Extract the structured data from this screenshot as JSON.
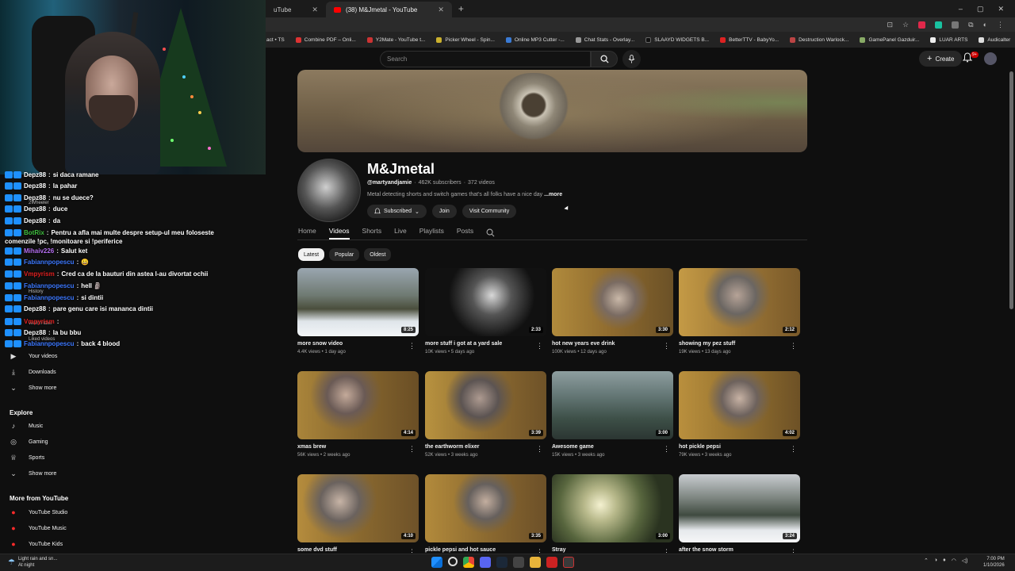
{
  "browser": {
    "tabs": [
      {
        "label": "uTube",
        "active": false
      },
      {
        "label": "(38) M&Jmetal - YouTube",
        "active": true
      }
    ],
    "bookmarks": [
      "act • TS",
      "Combine PDF – Onli...",
      "Y2Mate - YouTube t...",
      "Picker Wheel - Spin...",
      "Online MP3 Cutter -...",
      "Chat Stats - Overlay...",
      "SLAAYD WIDGETS B...",
      "BetterTTV - BabyYo...",
      "Destruction Warlock...",
      "GamePanel Gazduir...",
      "LUAR ARTS",
      "Audicalter"
    ]
  },
  "youtube_header": {
    "search_placeholder": "Search",
    "create_label": "Create",
    "notif_badge": "9+"
  },
  "channel": {
    "name": "M&Jmetal",
    "handle": "@martyandjamie",
    "subscribers": "462K subscribers",
    "video_count": "372 videos",
    "description": "Metal detecting shorts and switch games that's all folks have a nice day",
    "more_label": "...more",
    "subscribed_label": "Subscribed",
    "join_label": "Join",
    "community_label": "Visit Community"
  },
  "tabs": [
    "Home",
    "Videos",
    "Shorts",
    "Live",
    "Playlists",
    "Posts"
  ],
  "active_tab": "Videos",
  "chips": [
    "Latest",
    "Popular",
    "Oldest"
  ],
  "videos": [
    {
      "title": "more snow video",
      "views": "4.4K views",
      "age": "1 day ago",
      "duration": "8:25"
    },
    {
      "title": "more stuff i got at a yard sale",
      "views": "10K views",
      "age": "5 days ago",
      "duration": "2:33"
    },
    {
      "title": "hot new years eve drink",
      "views": "100K views",
      "age": "12 days ago",
      "duration": "3:30"
    },
    {
      "title": "showing my pez stuff",
      "views": "19K views",
      "age": "13 days ago",
      "duration": "2:12"
    },
    {
      "title": "xmas brew",
      "views": "56K views",
      "age": "2 weeks ago",
      "duration": "4:14"
    },
    {
      "title": "the earthworm elixer",
      "views": "52K views",
      "age": "3 weeks ago",
      "duration": "3:39"
    },
    {
      "title": "Awesome game",
      "views": "15K views",
      "age": "3 weeks ago",
      "duration": "3:00"
    },
    {
      "title": "hot pickle pepsi",
      "views": "79K views",
      "age": "3 weeks ago",
      "duration": "4:02"
    },
    {
      "title": "some dvd stuff",
      "views": "",
      "age": "",
      "duration": "4:10"
    },
    {
      "title": "pickle pepsi and hot sauce",
      "views": "",
      "age": "",
      "duration": "3:35"
    },
    {
      "title": "Stray",
      "views": "",
      "age": "",
      "duration": "3:00"
    },
    {
      "title": "after the snow storm",
      "views": "",
      "age": "",
      "duration": "3:24"
    }
  ],
  "sidebar": {
    "ghost_items": [
      "2Wheeler",
      "History",
      "Watch later",
      "Liked videos"
    ],
    "you_items": [
      "Your videos",
      "Downloads",
      "Show more"
    ],
    "explore_heading": "Explore",
    "explore_items": [
      "Music",
      "Gaming",
      "Sports",
      "Show more"
    ],
    "more_heading": "More from YouTube",
    "more_items": [
      "YouTube Studio",
      "YouTube Music",
      "YouTube Kids"
    ]
  },
  "chat": [
    {
      "user": "Depz88",
      "color": "#ffffff",
      "msg": "si daca ramane"
    },
    {
      "user": "Depz88",
      "color": "#ffffff",
      "msg": "la pahar"
    },
    {
      "user": "Depz88",
      "color": "#ffffff",
      "msg": "nu se duece?"
    },
    {
      "user": "Depz88",
      "color": "#ffffff",
      "msg": "duce"
    },
    {
      "user": "Depz88",
      "color": "#ffffff",
      "msg": "da"
    },
    {
      "user": "BotRix",
      "color": "#3fbf3f",
      "msg": "Pentru a afla mai multe despre setup-ul meu foloseste"
    },
    {
      "user": "",
      "color": "#ffffff",
      "msg": "comenzile !pc, !monitoare si !periferice"
    },
    {
      "user": "Mihaiv226",
      "color": "#b46ef0",
      "msg": "Salut ket"
    },
    {
      "user": "Fabiannpopescu",
      "color": "#3c78ff",
      "msg": "😀"
    },
    {
      "user": "Vmpyrism",
      "color": "#e02020",
      "msg": "Cred ca de la bauturi din astea l-au divortat ochii"
    },
    {
      "user": "Fabiannpopescu",
      "color": "#3c78ff",
      "msg": "hell 🗿"
    },
    {
      "user": "Fabiannpopescu",
      "color": "#3c78ff",
      "msg": "si dintii"
    },
    {
      "user": "Depz88",
      "color": "#ffffff",
      "msg": "pare genu care isi mananca dintii"
    },
    {
      "user": "Vmpyrism",
      "color": "#e02020",
      "msg": ""
    },
    {
      "user": "Depz88",
      "color": "#ffffff",
      "msg": "la bu bbu"
    },
    {
      "user": "Fabiannpopescu",
      "color": "#3c78ff",
      "msg": "back 4 blood"
    }
  ],
  "taskbar": {
    "weather_line1": "Light rain and sn...",
    "weather_line2": "At night",
    "time": "7:00 PM",
    "date": "1/10/2026"
  }
}
